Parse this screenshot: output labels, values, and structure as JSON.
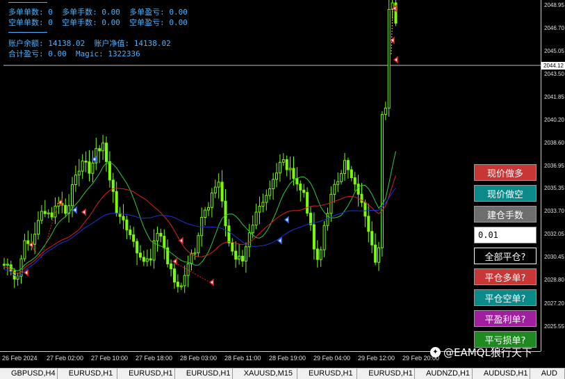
{
  "info": {
    "line1": "多单单数: 0  多单手数: 0.00  多单盈亏: 0.00",
    "line2": "空单单数: 0  空单手数: 0.00  空单盈亏: 0.00",
    "line3": "账户余额: 14138.02  账户净值: 14138.02",
    "line4": "合计盈亏: 0.00  Magic: 1322336",
    "text_color": "#4fb2ff"
  },
  "price_axis": {
    "labels": [
      "2048.95",
      "2046.70",
      "2045.05",
      "2043.50",
      "2041.85",
      "2040.20",
      "2038.60",
      "2036.95",
      "2035.35",
      "2033.70",
      "2032.05",
      "2030.45",
      "2028.80",
      "2027.20",
      "2025.55"
    ],
    "current_price": "2044.12",
    "max": 2049.3,
    "min": 2023.75
  },
  "time_axis": {
    "labels": [
      "26 Feb 2024",
      "27 Feb 02:00",
      "27 Feb 10:00",
      "27 Feb 18:00",
      "28 Feb 03:00",
      "28 Feb 11:00",
      "28 Feb 19:00",
      "29 Feb 04:00",
      "29 Feb 12:00",
      "29 Feb 20:00"
    ]
  },
  "buttons": {
    "buy": {
      "label": "现价做多",
      "color": "#c93636"
    },
    "sell": {
      "label": "现价做空",
      "color": "#0b8a8a"
    },
    "lots_label": {
      "label": "建仓手数",
      "color": "#6e6e6e"
    },
    "lot_value": "0.01",
    "close_all": {
      "label": "全部平仓?",
      "color": "#000000"
    },
    "close_buy": {
      "label": "平仓多单?",
      "color": "#c93636"
    },
    "close_sell": {
      "label": "平仓空单?",
      "color": "#0b8a8a"
    },
    "close_profit": {
      "label": "平盈利单?",
      "color": "#a11ea1"
    },
    "close_loss": {
      "label": "平亏损单?",
      "color": "#1f8a1f"
    }
  },
  "watermark": {
    "text": "@EAMQL狼行天下"
  },
  "symbol_tabs": [
    "GBPUSD,H4",
    "EURUSD,H1",
    "EURUSD,H1",
    "EURUSD,H1",
    "XAUUSD,M15",
    "EURUSD,H1",
    "EURUSD,H1",
    "AUDNZD,H1",
    "AUDUSD,H1",
    "AUD"
  ],
  "colors": {
    "candle": "#7cfc00",
    "ma_fast": "#2ecc40",
    "ma_mid": "#e02020",
    "ma_slow": "#2030e0",
    "grid_line": "#cfcfcf"
  }
}
